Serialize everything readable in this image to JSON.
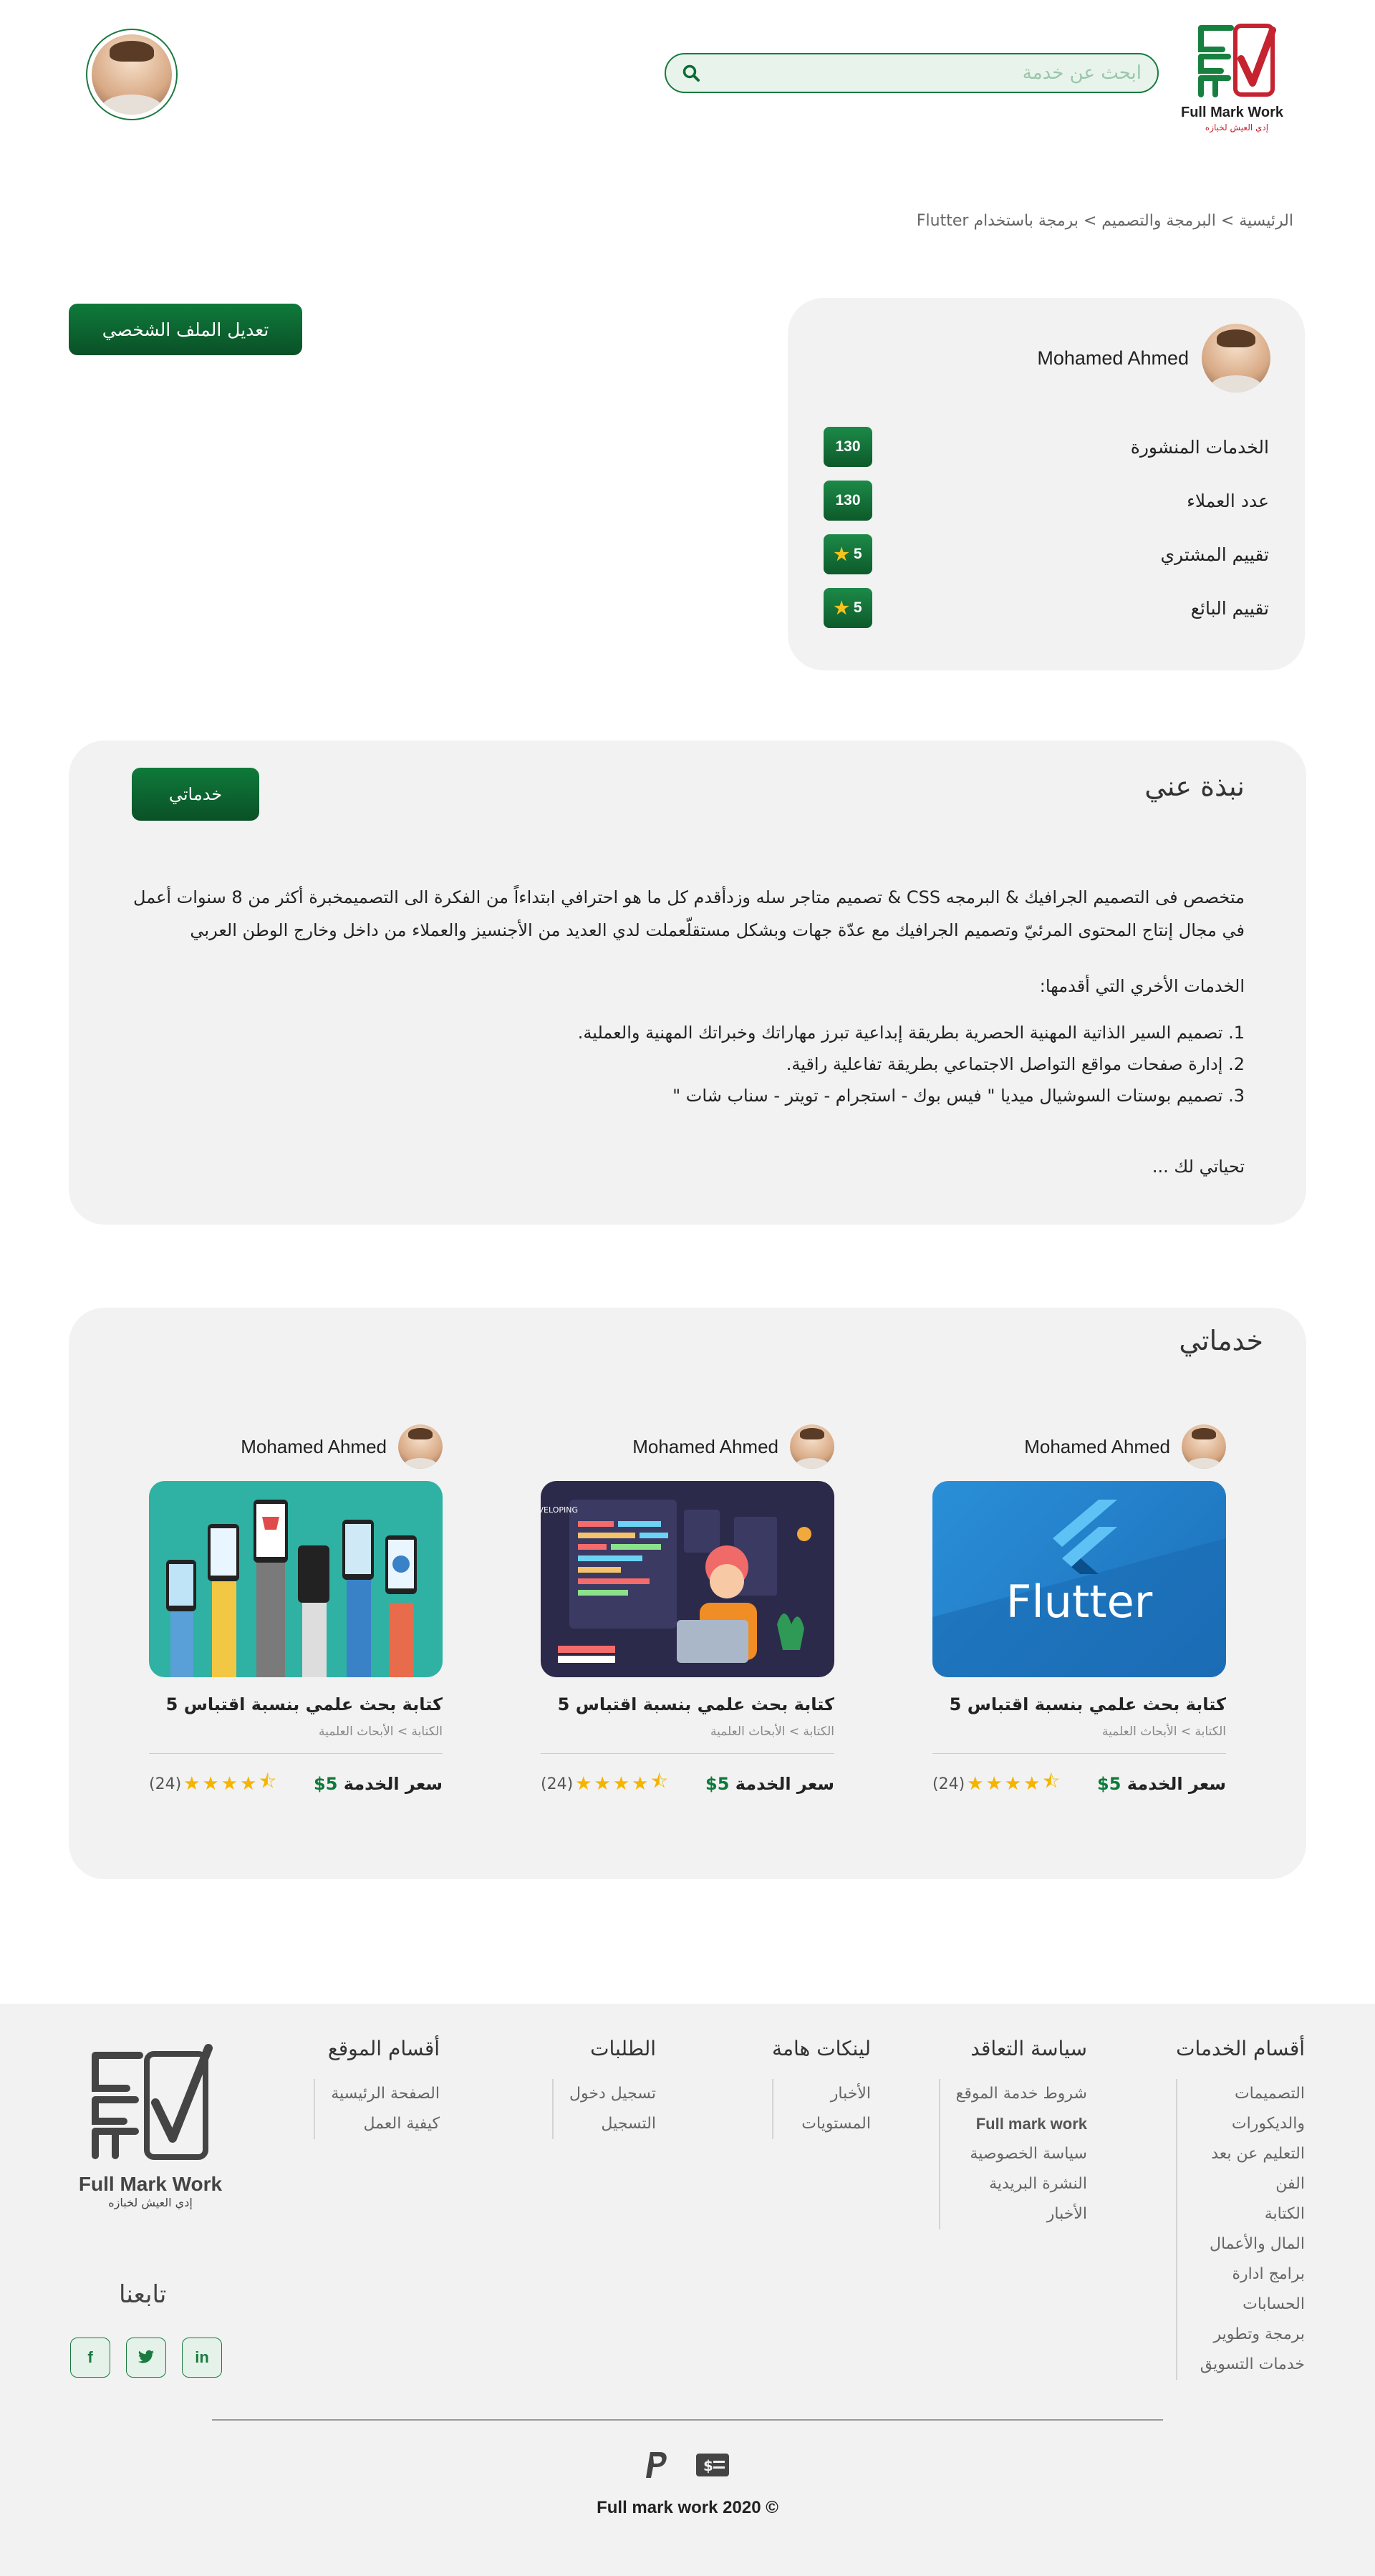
{
  "header": {
    "logo_brand": "Full Mark Work",
    "logo_sub": "إدي العيش لخبازه",
    "search_placeholder": "ابحث عن خدمة"
  },
  "breadcrumb": "الرئيسية > البرمجة والتصميم > برمجة باستخدام Flutter",
  "profile": {
    "name": "Mohamed Ahmed",
    "edit_button": "تعديل الملف الشخصي",
    "stats": [
      {
        "label": "الخدمات المنشورة",
        "value": "130"
      },
      {
        "label": "عدد العملاء",
        "value": "130"
      },
      {
        "label": "تقييم المشتري",
        "value": "5"
      },
      {
        "label": "تقييم البائع",
        "value": "5"
      }
    ]
  },
  "about": {
    "title": "نبذة عني",
    "button": "خدماتي",
    "paragraph_line1": "متخصص فى التصميم الجرافيك & البرمجه CSS & تصميم متاجر سله وزدأقدم كل ما هو احترافي ابتداءاً من الفكرة الى التصميمخبرة أكثر من 8 سنوات أعمل",
    "paragraph_line2": "في مجال إنتاج المحتوى المرئيّ وتصميم الجرافيك مع عدّة جهات وبشكل مستقلّعملت لدي العديد من الأجنسيز والعملاء من داخل وخارج الوطن العربي",
    "services_heading": "الخدمات الأخري التي أقدمها:",
    "list": [
      "1. تصميم السير الذاتية المهنية الحصرية بطريقة إبداعية تبرز مهاراتك وخبراتك المهنية والعملية.",
      "2. إدارة صفحات مواقع التواصل الاجتماعي بطريقة تفاعلية راقية.",
      "3. تصميم بوستات السوشيال ميديا \" فيس بوك - استجرام - تويتر - سناب شات \""
    ],
    "closing": "تحياتي لك ..."
  },
  "services": {
    "title": "خدماتي",
    "items": [
      {
        "seller": "Mohamed Ahmed",
        "title": "كتابة بحث علمي بنسبة اقتباس 5",
        "category": "الكتابة > الأبحاث العلمية",
        "price_label": "سعر الخدمة",
        "price": "5$",
        "rating_count": "(24)",
        "image": "flutter",
        "image_text": "Flutter"
      },
      {
        "seller": "Mohamed Ahmed",
        "title": "كتابة بحث علمي بنسبة اقتباس 5",
        "category": "الكتابة > الأبحاث العلمية",
        "price_label": "سعر الخدمة",
        "price": "5$",
        "rating_count": "(24)",
        "image": "web-developing",
        "image_text": "WEB DEVELOPING"
      },
      {
        "seller": "Mohamed Ahmed",
        "title": "كتابة بحث علمي بنسبة اقتباس 5",
        "category": "الكتابة > الأبحاث العلمية",
        "price_label": "سعر الخدمة",
        "price": "5$",
        "rating_count": "(24)",
        "image": "mobile-hands",
        "image_text": ""
      }
    ]
  },
  "footer": {
    "columns": [
      {
        "head": "أقسام الخدمات",
        "items": [
          "التصميمات",
          "والديكورات",
          "التعليم عن بعد",
          "الفن",
          "الكتابة",
          "المال والأعمال",
          "برامج ادارة",
          "الحسابات",
          "برمجة وتطوير",
          "خدمات التسويق"
        ]
      },
      {
        "head": "سياسة التعاقد",
        "items": [
          "شروط خدمة الموقع",
          "Full mark work",
          "سياسة الخصوصية",
          "النشرة البريدية",
          "الأخبار"
        ]
      },
      {
        "head": "لينكات هامة",
        "items": [
          "الأخبار",
          "المستويات"
        ]
      },
      {
        "head": "الطلبات",
        "items": [
          "تسجيل دخول",
          "التسجيل"
        ]
      },
      {
        "head": "أقسام الموقع",
        "items": [
          "الصفحة الرئيسية",
          "كيفية العمل"
        ]
      }
    ],
    "logo_brand": "Full Mark Work",
    "logo_sub": "إدي العيش لخبازه",
    "follow": "تابعنا",
    "social": [
      "f",
      "t",
      "in"
    ],
    "copyright": "Full mark work 2020 ©"
  }
}
